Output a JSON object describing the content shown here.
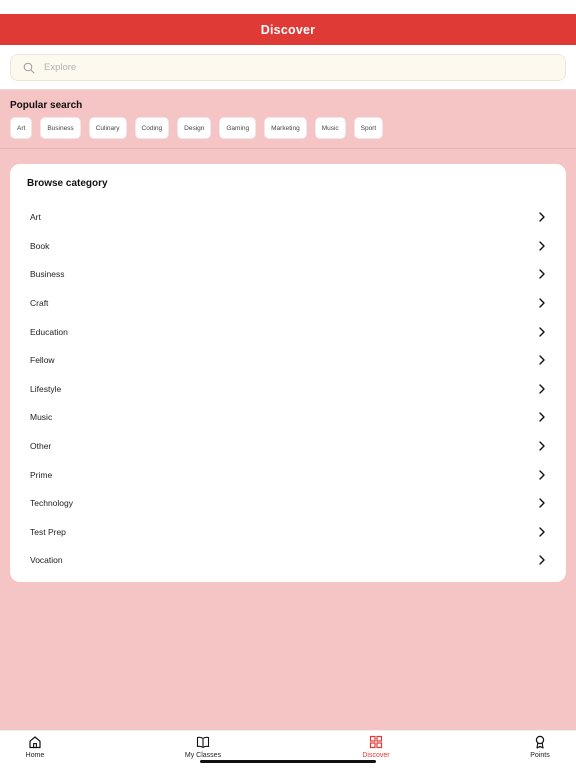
{
  "header": {
    "title": "Discover"
  },
  "search": {
    "placeholder": "Explore",
    "value": ""
  },
  "popular": {
    "title": "Popular search",
    "chips": [
      "Art",
      "Business",
      "Culinary",
      "Coding",
      "Design",
      "Gaming",
      "Marketing",
      "Music",
      "Sport"
    ]
  },
  "browse": {
    "title": "Browse category",
    "items": [
      "Art",
      "Book",
      "Business",
      "Craft",
      "Education",
      "Fellow",
      "Lifestyle",
      "Music",
      "Other",
      "Prime",
      "Technology",
      "Test Prep",
      "Vocation"
    ]
  },
  "tabs": [
    {
      "label": "Home",
      "icon": "home-icon",
      "active": false
    },
    {
      "label": "My Classes",
      "icon": "book-icon",
      "active": false
    },
    {
      "label": "Discover",
      "icon": "grid-icon",
      "active": true
    },
    {
      "label": "Points",
      "icon": "award-icon",
      "active": false
    }
  ],
  "colors": {
    "accent": "#e03a36",
    "background": "#f5c4c4",
    "card": "#ffffff"
  }
}
